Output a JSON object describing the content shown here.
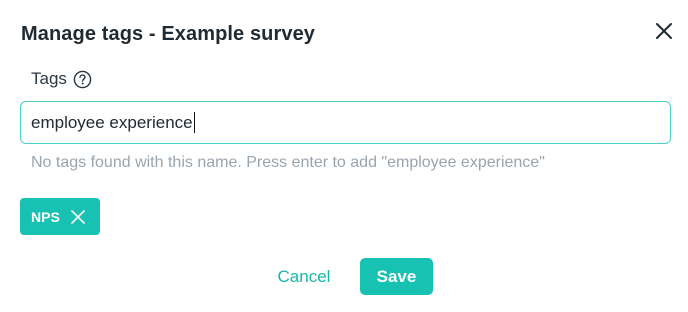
{
  "dialog": {
    "title": "Manage tags - Example survey",
    "close_icon": "close-icon"
  },
  "tags_field": {
    "label": "Tags",
    "help_icon": "question-circle-icon",
    "value": "employee experience",
    "hint": "No tags found with this name. Press enter to add \"employee experience\""
  },
  "chips": [
    {
      "label": "NPS",
      "remove_icon": "x-icon"
    }
  ],
  "actions": {
    "cancel_label": "Cancel",
    "save_label": "Save"
  },
  "colors": {
    "accent": "#17c2b2",
    "input_border": "#4dd3c5",
    "title_text": "#1f2a33",
    "hint_text": "#9aa4ad"
  }
}
